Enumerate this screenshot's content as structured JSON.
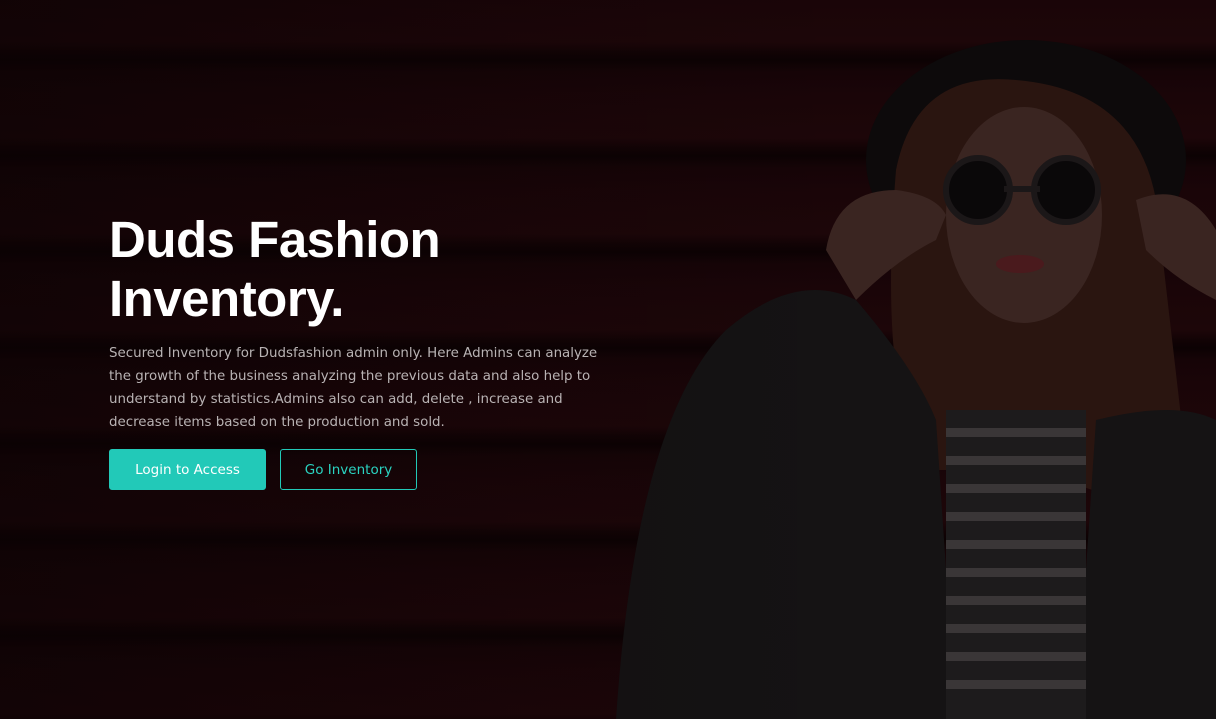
{
  "hero": {
    "title_line1": "Duds Fashion",
    "title_line2": "Inventory.",
    "description": "Secured Inventory for Dudsfashion admin only. Here Admins can analyze the growth of the business analyzing the previous data and also help to understand by statistics.Admins also can add, delete , increase and decrease items based on the production and sold.",
    "primary_button": "Login to Access",
    "secondary_button": "Go Inventory"
  },
  "colors": {
    "accent": "#22c9b8",
    "background": "#170406",
    "title": "#ffffff",
    "body_text": "#b9b3b4"
  },
  "icons": [
    "background-model-photo"
  ]
}
